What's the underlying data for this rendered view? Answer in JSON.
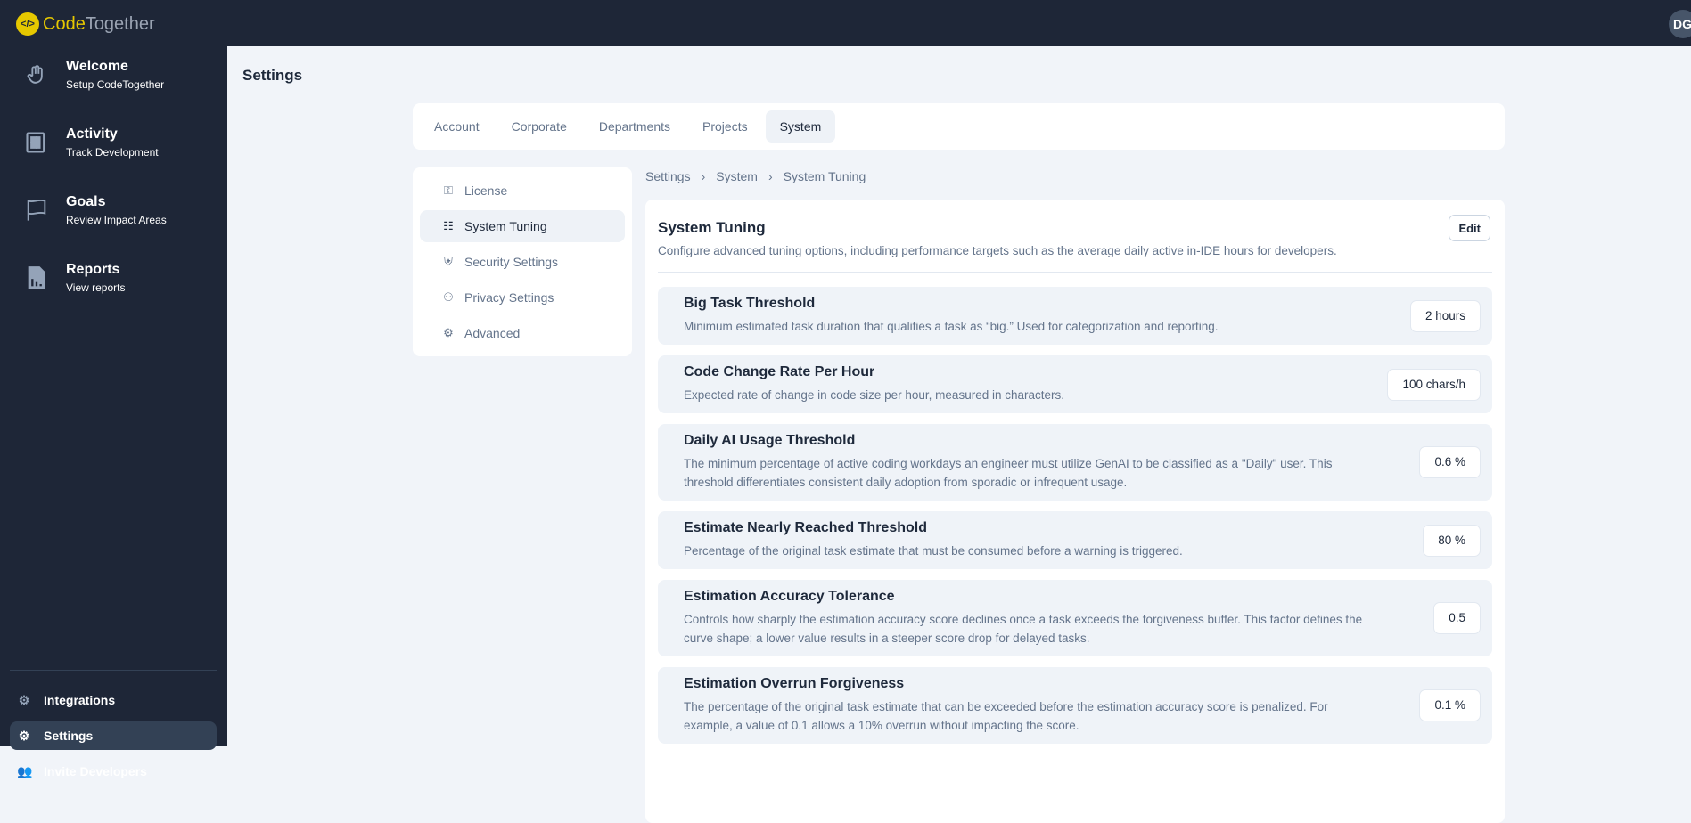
{
  "app": {
    "logo_prefix": "Code",
    "logo_suffix": "Together",
    "user_initials": "DG"
  },
  "sidebar": {
    "main": [
      {
        "title": "Welcome",
        "subtitle": "Setup CodeTogether",
        "icon": "wave-hand-icon"
      },
      {
        "title": "Activity",
        "subtitle": "Track Development",
        "icon": "dashboard-icon"
      },
      {
        "title": "Goals",
        "subtitle": "Review Impact Areas",
        "icon": "flag-icon"
      },
      {
        "title": "Reports",
        "subtitle": "View reports",
        "icon": "report-icon"
      }
    ],
    "bottom": [
      {
        "label": "Integrations",
        "icon": "gears-icon"
      },
      {
        "label": "Settings",
        "icon": "gear-icon",
        "active": true
      },
      {
        "label": "Invite Developers",
        "icon": "users-icon"
      }
    ]
  },
  "page": {
    "title": "Settings"
  },
  "tabs": [
    "Account",
    "Corporate",
    "Departments",
    "Projects",
    "System"
  ],
  "active_tab": "System",
  "subnav": [
    {
      "label": "License",
      "icon": "key-icon"
    },
    {
      "label": "System Tuning",
      "icon": "sliders-icon",
      "active": true
    },
    {
      "label": "Security Settings",
      "icon": "shield-icon"
    },
    {
      "label": "Privacy Settings",
      "icon": "user-lock-icon"
    },
    {
      "label": "Advanced",
      "icon": "gear-icon"
    }
  ],
  "breadcrumb": [
    "Settings",
    "System",
    "System Tuning"
  ],
  "card": {
    "title": "System Tuning",
    "description": "Configure advanced tuning options, including performance targets such as the average daily active in-IDE hours for developers.",
    "edit_label": "Edit",
    "settings": [
      {
        "title": "Big Task Threshold",
        "description": "Minimum estimated task duration that qualifies a task as “big.” Used for categorization and reporting.",
        "value": "2 hours"
      },
      {
        "title": "Code Change Rate Per Hour",
        "description": "Expected rate of change in code size per hour, measured in characters.",
        "value": "100 chars/h"
      },
      {
        "title": "Daily AI Usage Threshold",
        "description": "The minimum percentage of active coding workdays an engineer must utilize GenAI to be classified as a \"Daily\" user. This threshold differentiates consistent daily adoption from sporadic or infrequent usage.",
        "value": "0.6 %"
      },
      {
        "title": "Estimate Nearly Reached Threshold",
        "description": "Percentage of the original task estimate that must be consumed before a warning is triggered.",
        "value": "80 %"
      },
      {
        "title": "Estimation Accuracy Tolerance",
        "description": "Controls how sharply the estimation accuracy score declines once a task exceeds the forgiveness buffer. This factor defines the curve shape; a lower value results in a steeper score drop for delayed tasks.",
        "value": "0.5"
      },
      {
        "title": "Estimation Overrun Forgiveness",
        "description": "The percentage of the original task estimate that can be exceeded before the estimation accuracy score is penalized. For example, a value of 0.1 allows a 10% overrun without impacting the score.",
        "value": "0.1 %"
      }
    ]
  }
}
